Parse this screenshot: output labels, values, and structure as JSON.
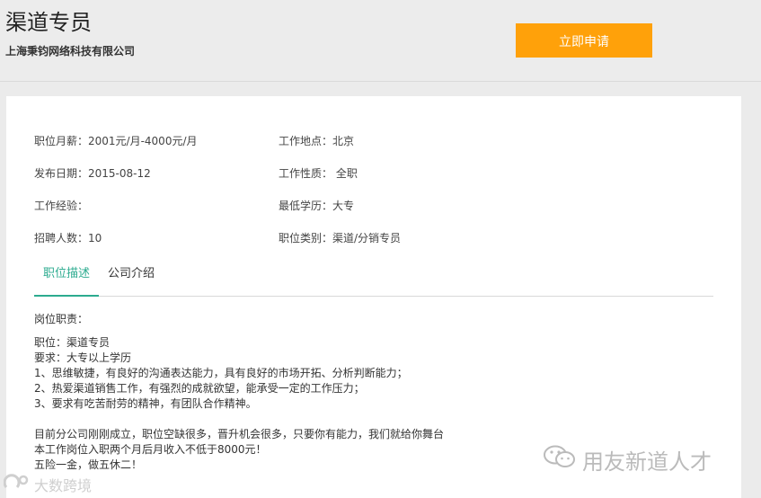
{
  "header": {
    "job_title": "渠道专员",
    "company": "上海秉钧网络科技有限公司",
    "apply_label": "立即申请"
  },
  "info": {
    "salary": "职位月薪：2001元/月-4000元/月",
    "location": "工作地点：北京",
    "publish_date": "发布日期：2015-08-12",
    "job_type": "工作性质： 全职",
    "experience": "工作经验：",
    "education": "最低学历：大专",
    "headcount": "招聘人数：10",
    "category": "职位类别：渠道/分销专员"
  },
  "tabs": {
    "description": "职位描述",
    "company": "公司介绍"
  },
  "description": {
    "heading": "岗位职责：",
    "lines": [
      "职位：渠道专员",
      "要求：大专以上学历",
      "1、思维敏捷，有良好的沟通表达能力，具有良好的市场开拓、分析判断能力；",
      "2、热爱渠道销售工作，有强烈的成就欲望，能承受一定的工作压力；",
      "3、要求有吃苦耐劳的精神，有团队合作精神。"
    ],
    "lines2": [
      "目前分公司刚刚成立，职位空缺很多，晋升机会很多，只要你有能力，我们就给你舞台",
      "本工作岗位入职两个月后月收入不低于8000元！",
      "五险一金，做五休二！"
    ]
  },
  "watermarks": {
    "right_text": "用友新道人才",
    "right_icon": "wechat-icon",
    "left_text": "大数跨境",
    "left_icon": "logo-icon"
  },
  "colors": {
    "accent": "#2cab8f",
    "apply_button": "#ffa10a",
    "header_bg": "#ececec",
    "page_bg": "#ebebeb"
  }
}
